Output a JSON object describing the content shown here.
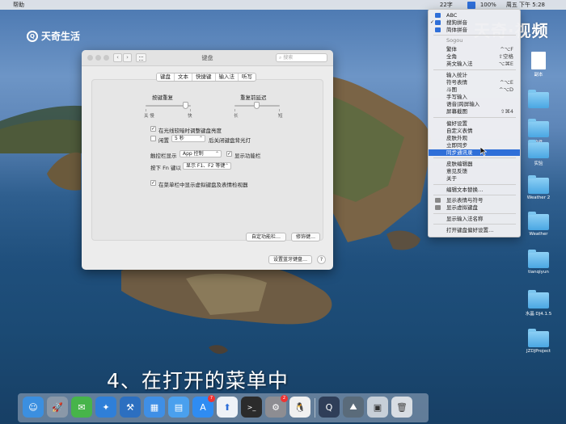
{
  "menubar": {
    "apple": "",
    "help": "帮助",
    "right_items": [
      "22字",
      "",
      "",
      "",
      "100%",
      "",
      "周五 下午 5:28",
      "",
      "",
      ""
    ]
  },
  "watermark_left": "天奇生活",
  "watermark_right": "天奇·视频",
  "prefs": {
    "title": "键盘",
    "search_placeholder": "搜索",
    "tabs": [
      "键盘",
      "文本",
      "快捷键",
      "输入法",
      "听写"
    ],
    "key_repeat": {
      "label": "按键重复",
      "min": "关 慢",
      "max": "快"
    },
    "repeat_delay": {
      "label": "重复前延迟",
      "min": "长",
      "max": "短"
    },
    "auto_brightness": "在光线较暗时调整键盘亮度",
    "backlight_off_label": "闲置",
    "backlight_off_value": "5 秒",
    "backlight_off_suffix": "后关闭键盘背光灯",
    "touchbar_label": "触控栏显示",
    "touchbar_value": "App 控制",
    "show_control_strip": "显示功能栏",
    "fn_label": "按下 Fn 键以",
    "fn_value": "显示 F1、F2 等键",
    "show_viewers": "在菜单栏中显示虚拟键盘及表情检视器",
    "customize_btn": "自定功能栏…",
    "modifier_btn": "修饰键…",
    "bluetooth_btn": "设置蓝牙键盘…",
    "help_btn": "?"
  },
  "ime_menu": {
    "items": [
      {
        "label": "ABC",
        "shortcut": "",
        "checked": false,
        "icon": true
      },
      {
        "label": "搜狗拼音",
        "shortcut": "",
        "checked": true,
        "icon": true
      },
      {
        "label": "简体拼音",
        "shortcut": "",
        "checked": false,
        "icon": true
      },
      {
        "label": "Sogou",
        "shortcut": "",
        "dim": true
      },
      {
        "label": "繁体",
        "shortcut": "^⌥F"
      },
      {
        "label": "全角",
        "shortcut": "⇧空格"
      },
      {
        "label": "英文输入法",
        "shortcut": "⌥⌘E"
      },
      {
        "label": "输入统计",
        "shortcut": ""
      },
      {
        "label": "符号表情",
        "shortcut": "^⌥E"
      },
      {
        "label": "斗图",
        "shortcut": "^⌥D"
      },
      {
        "label": "手写输入",
        "shortcut": ""
      },
      {
        "label": "语音|跨屏输入",
        "shortcut": ""
      },
      {
        "label": "屏幕截图",
        "shortcut": "⇧⌘4"
      },
      {
        "label": "偏好设置",
        "shortcut": ""
      },
      {
        "label": "自定义表情",
        "shortcut": ""
      },
      {
        "label": "皮肤外观",
        "shortcut": ""
      },
      {
        "label": "立即同步",
        "shortcut": ""
      },
      {
        "label": "同步通讯录",
        "shortcut": "",
        "highlighted": true
      },
      {
        "label": "皮肤编辑器",
        "shortcut": ""
      },
      {
        "label": "意见反馈",
        "shortcut": ""
      },
      {
        "label": "关于",
        "shortcut": ""
      },
      {
        "label": "编辑文本替换…",
        "shortcut": ""
      },
      {
        "label": "显示表情与符号",
        "shortcut": "",
        "icon": true
      },
      {
        "label": "显示虚拟键盘",
        "shortcut": "",
        "icon": true
      },
      {
        "label": "显示输入法名称",
        "shortcut": ""
      },
      {
        "label": "打开键盘偏好设置…",
        "shortcut": ""
      }
    ]
  },
  "desktop_icons": [
    "副本",
    "",
    "文件",
    "实验",
    "Weather 2",
    "Weather",
    "tianqiyun",
    "水晶 DJ4.1.5",
    "JZDJProject"
  ],
  "subtitle": "4、在打开的菜单中",
  "dock": {
    "badges": [
      "7",
      "2"
    ],
    "terminal_glyph": ">_"
  },
  "colors": {
    "accent": "#2f6fd8",
    "highlight": "#2f6fd8",
    "menubar": "#e6e8ec"
  }
}
